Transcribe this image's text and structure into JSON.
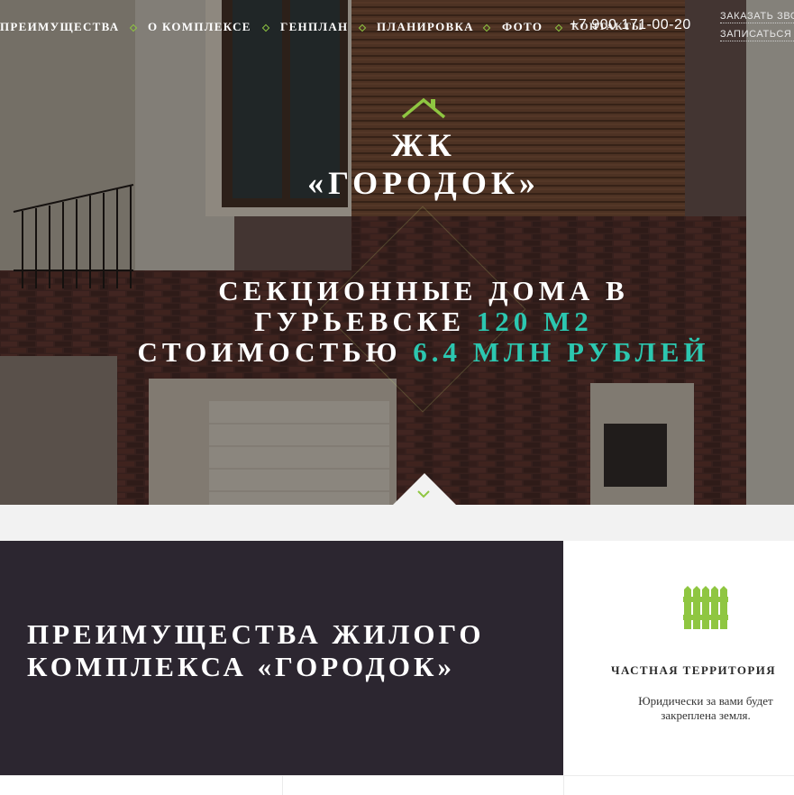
{
  "nav": {
    "items": [
      {
        "label": "ПРЕИМУЩЕСТВА"
      },
      {
        "label": "О КОМПЛЕКСЕ"
      },
      {
        "label": "ГЕНПЛАН"
      },
      {
        "label": "ПЛАНИРОВКА"
      },
      {
        "label": "ФОТО"
      }
    ],
    "overlapped_item": "КОНТАКТЫ",
    "phone": "+7 900 171-00-20",
    "call_link": "ЗАКАЗАТЬ ЗВОНОК",
    "visit_link": "ЗАПИСАТЬСЯ НА"
  },
  "hero": {
    "title_line1": "ЖК",
    "title_line2": "«ГОРОДОК»",
    "headline_line1": "СЕКЦИОННЫЕ ДОМА В",
    "headline_line2_text": "ГУРЬЕВСКЕ",
    "headline_line2_accent": "120 М2",
    "headline_line3_text": "СТОИМОСТЬЮ",
    "headline_line3_accent": "6.4 МЛН РУБЛЕЙ"
  },
  "advantages": {
    "title_line1": "ПРЕИМУЩЕСТВА ЖИЛОГО",
    "title_line2": "КОМПЛЕКСА «ГОРОДОК»",
    "card": {
      "icon": "fence-icon",
      "title": "ЧАСТНАЯ ТЕРРИТОРИЯ",
      "text": "Юридически за вами будет закреплена земля."
    }
  },
  "colors": {
    "accent_green": "#8fc641",
    "accent_teal": "#2cc7b0",
    "dark_panel": "#2c2630"
  }
}
